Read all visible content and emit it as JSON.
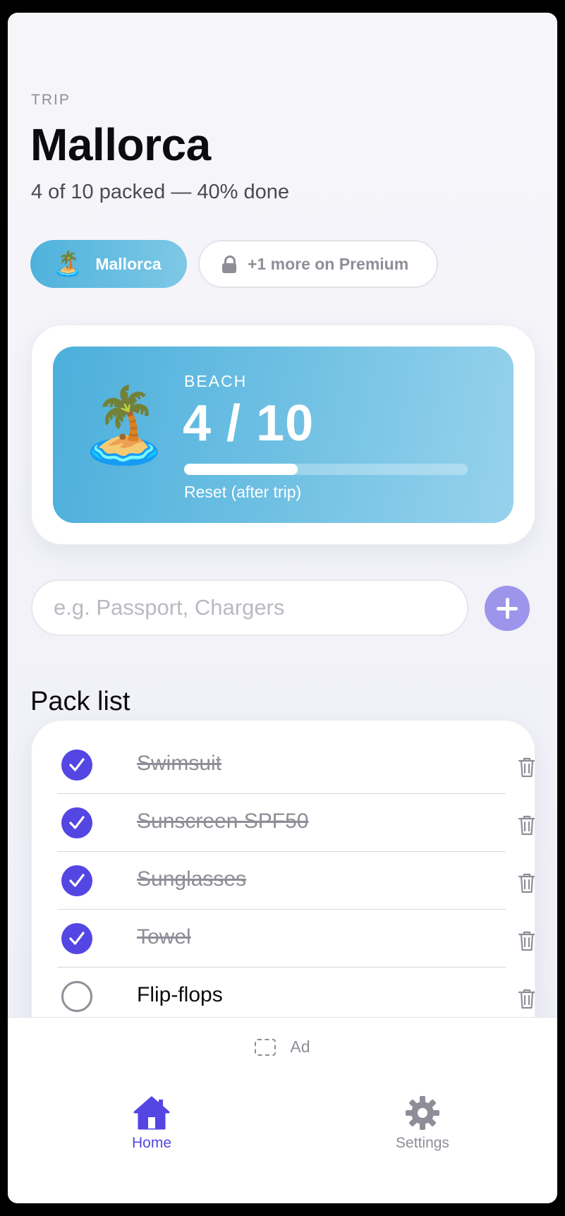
{
  "header": {
    "eyebrow": "TRIP",
    "title": "Mallorca",
    "subtitle": "4 of 10 packed — 40% done"
  },
  "trip_chips": {
    "active": {
      "emoji": "🏝️",
      "label": "Mallorca"
    },
    "premium": {
      "icon": "lock-icon",
      "label": "+1 more on Premium"
    }
  },
  "summary_card": {
    "emoji": "🏝️",
    "category": "BEACH",
    "count": "4 / 10",
    "progress": 0.4,
    "reset_label": "Reset (after trip)"
  },
  "add_item": {
    "placeholder": "e.g. Passport, Chargers",
    "value": "",
    "button_icon": "plus-icon"
  },
  "pack_list": {
    "title": "Pack list",
    "items": [
      {
        "label": "Swimsuit",
        "checked": true
      },
      {
        "label": "Sunscreen SPF50",
        "checked": true
      },
      {
        "label": "Sunglasses",
        "checked": true
      },
      {
        "label": "Towel",
        "checked": true
      },
      {
        "label": "Flip-flops",
        "checked": false
      }
    ]
  },
  "ad": {
    "label": "Ad"
  },
  "tab_bar": {
    "home": {
      "label": "Home",
      "icon": "home-icon",
      "active": true
    },
    "settings": {
      "label": "Settings",
      "icon": "gear-icon",
      "active": false
    }
  },
  "colors": {
    "accent": "#5446e3",
    "card_gradient_start": "#4cafdb",
    "card_gradient_end": "#97d2ec",
    "muted": "#8e8e98"
  }
}
